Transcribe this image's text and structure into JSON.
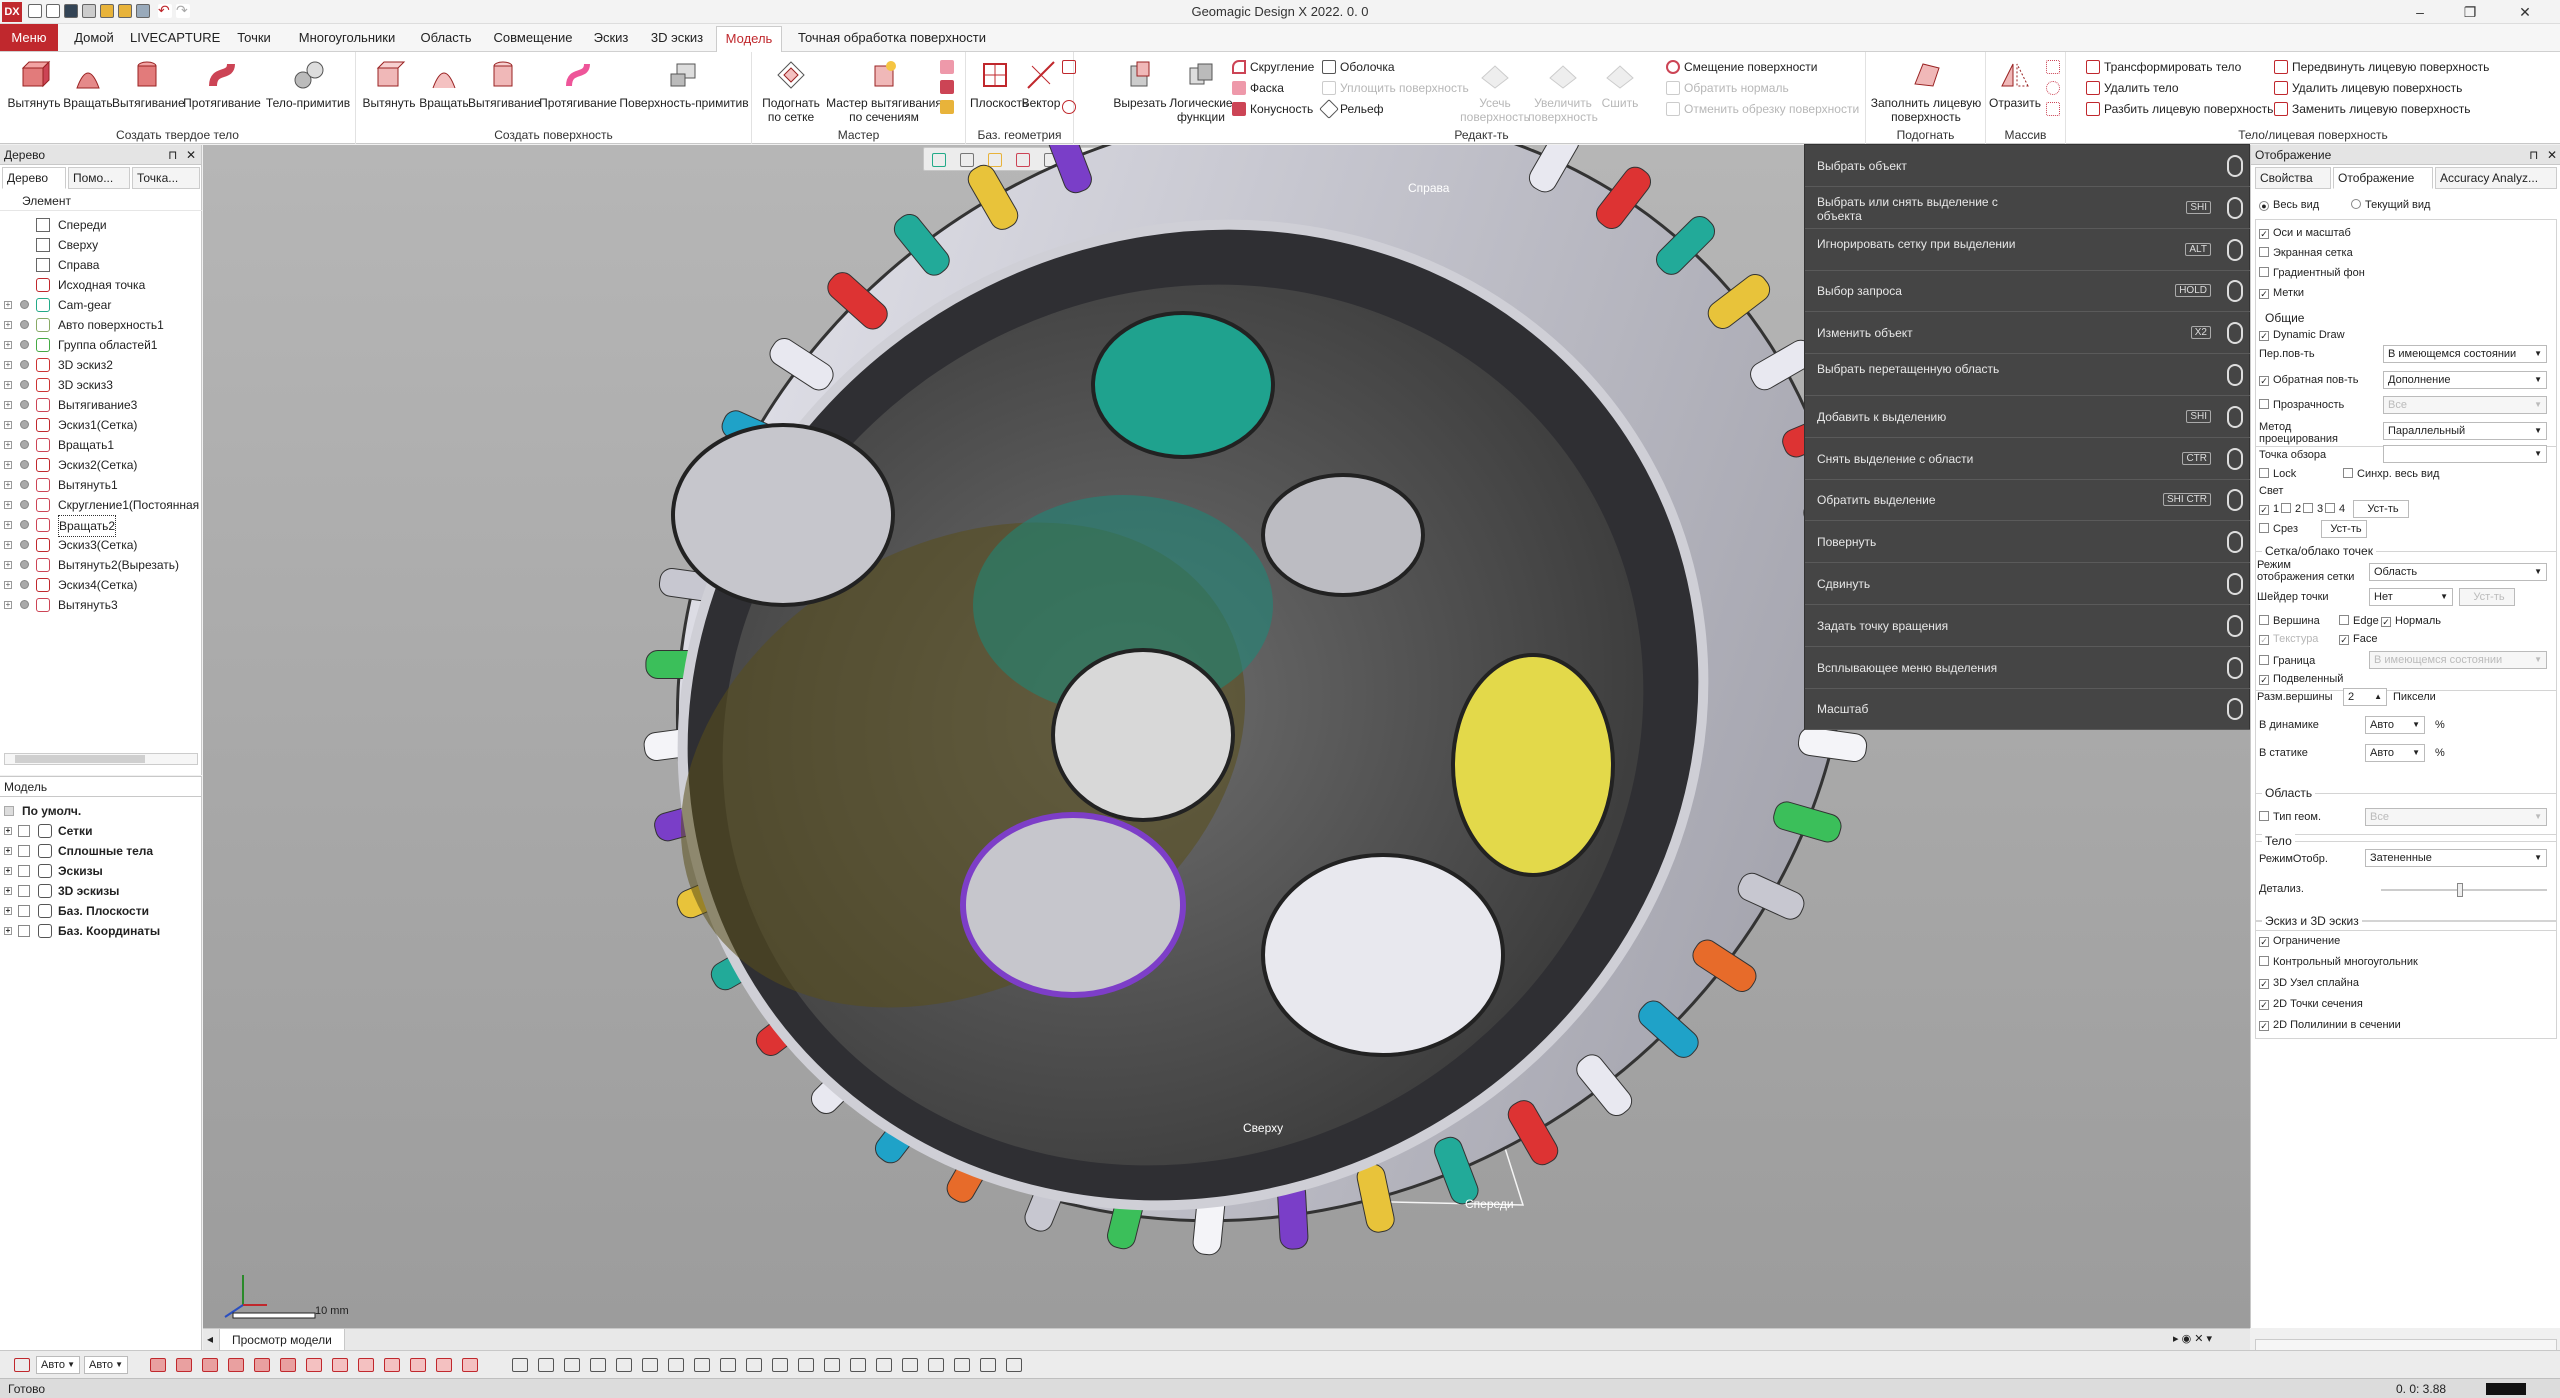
{
  "window": {
    "title": "Geomagic Design X 2022. 0. 0",
    "logo": "DX"
  },
  "tabs": [
    {
      "label": "Меню"
    },
    {
      "label": "Домой"
    },
    {
      "label": "LIVECAPTURE"
    },
    {
      "label": "Точки"
    },
    {
      "label": "Многоугольники"
    },
    {
      "label": "Область"
    },
    {
      "label": "Совмещение"
    },
    {
      "label": "Эскиз"
    },
    {
      "label": "3D эскиз"
    },
    {
      "label": "Модель"
    },
    {
      "label": "Точная обработка поверхности"
    }
  ],
  "ribbon": {
    "groups": {
      "solid": "Создать твердое тело",
      "surface": "Создать поверхность",
      "wizard": "Мастер",
      "refgeom": "Баз. геометрия",
      "edit": "Редакт-ть",
      "fit": "Подогнать",
      "array": "Массив",
      "bodyface": "Тело/лицевая поверхность"
    },
    "solid_buttons": [
      "Вытянуть",
      "Вращать",
      "Вытягивание",
      "Протягивание",
      "Тело-примитив"
    ],
    "surface_buttons": [
      "Вытянуть",
      "Вращать",
      "Вытягивание",
      "Протягивание",
      "Поверхность-примитив"
    ],
    "wizard_buttons": [
      "Подогнать по сетке",
      "Мастер вытягивания по сечениям"
    ],
    "refgeom_buttons": [
      "Плоскость",
      "Вектор"
    ],
    "edit_big": [
      "Вырезать",
      "Логические функции"
    ],
    "edit_small": [
      "Скругление",
      "Фаска",
      "Конусность",
      "Оболочка",
      "Уплощить поверхность",
      "Рельеф"
    ],
    "edit_disabled": [
      "Усечь поверхность",
      "Увеличить поверхность",
      "Сшить"
    ],
    "edit_offset": [
      "Смещение поверхности",
      "Обратить нормаль",
      "Отменить обрезку поверхности"
    ],
    "fit_button": "Заполнить лицевую поверхность",
    "array_button": "Отразить",
    "bodyface_buttons": [
      "Трансформировать тело",
      "Удалить тело",
      "Разбить лицевую поверхность",
      "Передвинуть лицевую поверхность",
      "Удалить лицевую поверхность",
      "Заменить лицевую поверхность"
    ]
  },
  "tree_panel": {
    "title": "Дерево",
    "subtabs": [
      "Дерево",
      "Помо...",
      "Точка..."
    ],
    "column": "Элемент",
    "items": [
      {
        "label": "Спереди"
      },
      {
        "label": "Сверху"
      },
      {
        "label": "Справа"
      },
      {
        "label": "Исходная точка"
      },
      {
        "label": "Cam-gear"
      },
      {
        "label": "Авто поверхность1"
      },
      {
        "label": "Группа областей1"
      },
      {
        "label": "3D эскиз2"
      },
      {
        "label": "3D эскиз3"
      },
      {
        "label": "Вытягивание3"
      },
      {
        "label": "Эскиз1(Сетка)"
      },
      {
        "label": "Вращать1"
      },
      {
        "label": "Эскиз2(Сетка)"
      },
      {
        "label": "Вытянуть1"
      },
      {
        "label": "Скругление1(Постоянная"
      },
      {
        "label": "Вращать2"
      },
      {
        "label": "Эскиз3(Сетка)"
      },
      {
        "label": "Вытянуть2(Вырезать)"
      },
      {
        "label": "Эскиз4(Сетка)"
      },
      {
        "label": "Вытянуть3"
      }
    ]
  },
  "model_panel": {
    "title": "Модель",
    "items": [
      {
        "label": "По умолч."
      },
      {
        "label": "Сетки"
      },
      {
        "label": "Сплошные тела"
      },
      {
        "label": "Эскизы"
      },
      {
        "label": "3D эскизы"
      },
      {
        "label": "Баз. Плоскости"
      },
      {
        "label": "Баз. Координаты"
      }
    ]
  },
  "viewport": {
    "plane_labels": {
      "right": "Справа",
      "top": "Сверху",
      "front": "Спереди"
    },
    "scale_label": "10 mm",
    "tab_label": "Просмотр модели"
  },
  "selection_menu": [
    {
      "label": "Выбрать объект",
      "key": ""
    },
    {
      "label": "Выбрать или снять выделение с объекта",
      "key": "SHI"
    },
    {
      "label": "Игнорировать сетку при выделении",
      "key": "ALT"
    },
    {
      "label": "Выбор запроса",
      "key": "HOLD"
    },
    {
      "label": "Изменить объект",
      "key": "X2"
    },
    {
      "label": "Выбрать перетащенную область",
      "key": ""
    },
    {
      "label": "Добавить к выделению",
      "key": "SHI"
    },
    {
      "label": "Снять выделение с области",
      "key": "CTR"
    },
    {
      "label": "Обратить выделение",
      "key": "SHI CTR"
    },
    {
      "label": "Повернуть",
      "key": ""
    },
    {
      "label": "Сдвинуть",
      "key": ""
    },
    {
      "label": "Задать точку вращения",
      "key": ""
    },
    {
      "label": "Всплывающее меню выделения",
      "key": ""
    },
    {
      "label": "Масштаб",
      "key": ""
    }
  ],
  "right_panel": {
    "title": "Отображение",
    "tabs": [
      "Свойства",
      "Отображение",
      "Accuracy Analyz..."
    ],
    "view_mode": {
      "all": "Весь вид",
      "current": "Текущий вид"
    },
    "top_checks": [
      {
        "label": "Оси и масштаб",
        "checked": true
      },
      {
        "label": "Экранная сетка",
        "checked": false
      },
      {
        "label": "Градиентный фон",
        "checked": false
      },
      {
        "label": "Метки",
        "checked": true
      }
    ],
    "general": {
      "title": "Общие",
      "dynamic_draw": "Dynamic Draw",
      "front_label": "Пер.пов-ть",
      "front_value": "В имеющемся состоянии",
      "back_label": "Обратная пов-ть",
      "back_value": "Дополнение",
      "transparency_label": "Прозрачность",
      "transparency_value": "Все",
      "projection_label": "Метод проецирования",
      "projection_value": "Параллельный",
      "viewpoint_label": "Точка обзора",
      "lock": "Lock",
      "sync": "Синхр. весь вид",
      "light_label": "Свет",
      "lights": [
        "1",
        "2",
        "3",
        "4"
      ],
      "set_btn": "Уст-ть",
      "section": "Срез",
      "set_btn2": "Уст-ть"
    },
    "mesh": {
      "title": "Сетка/облако точек",
      "mode_label": "Режим отображения сетки",
      "mode_value": "Область",
      "shader_label": "Шейдер точки",
      "shader_value": "Нет",
      "shader_btn": "Уст-ть",
      "vertex": "Вершина",
      "edge": "Edge",
      "normal": "Нормаль",
      "texture": "Текстура",
      "face": "Face",
      "border": "Граница",
      "border_value": "В имеющемся состоянии",
      "subdivided": "Подвеленный",
      "vertex_size_label": "Разм.вершины",
      "vertex_size_value": "2",
      "vertex_size_unit": "Пиксели",
      "dynamic_label": "В динамике",
      "dynamic_value": "Авто",
      "pct": "%",
      "static_label": "В статике",
      "static_value": "Авто"
    },
    "area": {
      "title": "Область",
      "geom_type": "Тип геом.",
      "geom_value": "Все"
    },
    "body": {
      "title": "Тело",
      "mode_label": "РежимОтобр.",
      "mode_value": "Затененные",
      "detail_label": "Детализ."
    },
    "sketch": {
      "title": "Эскиз и 3D эскиз",
      "items": [
        {
          "label": "Ограничение",
          "checked": true
        },
        {
          "label": "Контрольный многоугольник",
          "checked": false
        },
        {
          "label": "3D Узел сплайна",
          "checked": true
        },
        {
          "label": "2D Точки сечения",
          "checked": true
        },
        {
          "label": "2D Полилинии в сечении",
          "checked": true
        }
      ]
    }
  },
  "bottombar": {
    "auto1": "Авто",
    "auto2": "Авто"
  },
  "status": {
    "text": "Готово",
    "coords": "0. 0: 3.88"
  },
  "colors": {
    "accent": "#c0282d",
    "menu_dark": "#454545"
  }
}
